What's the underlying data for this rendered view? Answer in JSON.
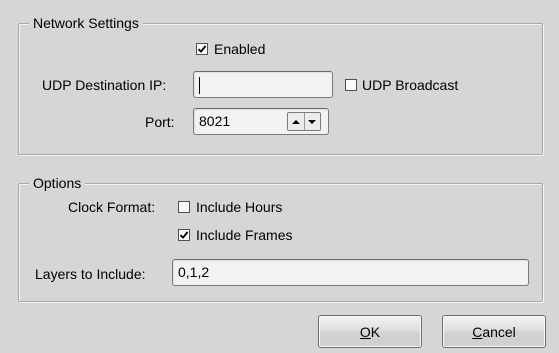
{
  "network": {
    "title": "Network Settings",
    "enabled_label": "Enabled",
    "enabled_checked": true,
    "udp_ip_label": "UDP Destination IP:",
    "udp_ip_value": "",
    "udp_broadcast_label": "UDP Broadcast",
    "udp_broadcast_checked": false,
    "port_label": "Port:",
    "port_value": "8021"
  },
  "options": {
    "title": "Options",
    "clock_format_label": "Clock Format:",
    "include_hours_label": "Include Hours",
    "include_hours_checked": false,
    "include_frames_label": "Include Frames",
    "include_frames_checked": true,
    "layers_label": "Layers to Include:",
    "layers_value": "0,1,2"
  },
  "buttons": {
    "ok_mnemonic": "O",
    "ok_rest": "K",
    "cancel_mnemonic": "C",
    "cancel_rest": "ancel"
  }
}
